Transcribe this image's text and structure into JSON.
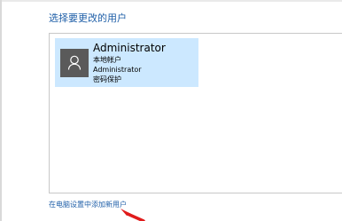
{
  "section": {
    "title": "选择要更改的用户"
  },
  "user": {
    "name": "Administrator",
    "account_type": "本地帐户",
    "group": "Administrator",
    "protection": "密码保护",
    "avatar_icon": "user-silhouette-icon"
  },
  "footer": {
    "add_user_link": "在电脑设置中添加新用户"
  },
  "colors": {
    "accent": "#1f5fa8",
    "selected_bg": "#cce8ff",
    "avatar_bg": "#5a5a5a",
    "annotation": "#e01b1b"
  }
}
